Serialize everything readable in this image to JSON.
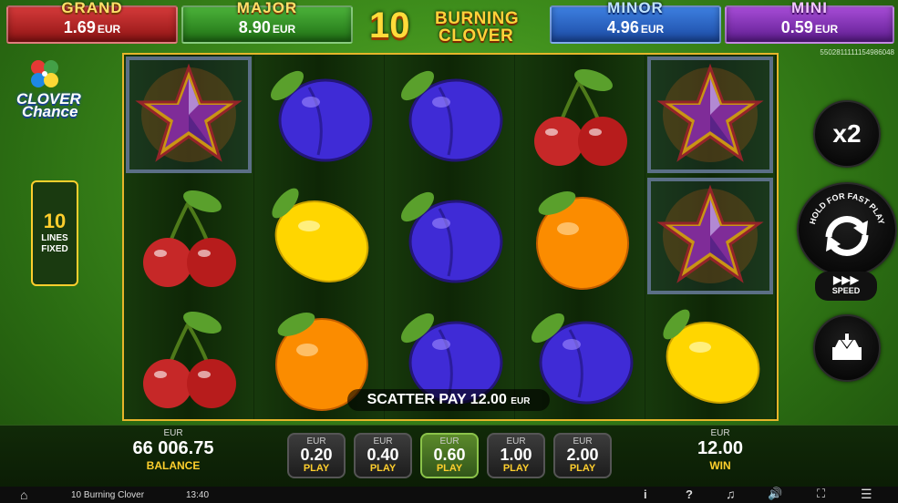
{
  "jackpots": {
    "grand": {
      "label": "GRAND",
      "value": "1.69",
      "currency": "EUR"
    },
    "major": {
      "label": "MAJOR",
      "value": "8.90",
      "currency": "EUR"
    },
    "minor": {
      "label": "MINOR",
      "value": "4.96",
      "currency": "EUR"
    },
    "mini": {
      "label": "MINI",
      "value": "0.59",
      "currency": "EUR"
    }
  },
  "logo": {
    "number": "10",
    "line1": "BURNING",
    "line2": "CLOVER"
  },
  "game_id": "5502811111154986048",
  "side_logo": {
    "line1": "CLOVER",
    "line2": "Chance"
  },
  "lines": {
    "count": "10",
    "line1": "LINES",
    "line2": "FIXED"
  },
  "reels": [
    [
      "star",
      "cherry",
      "cherry"
    ],
    [
      "plum",
      "lemon",
      "orange"
    ],
    [
      "plum",
      "plum",
      "plum"
    ],
    [
      "cherry",
      "orange",
      "plum"
    ],
    [
      "star",
      "star",
      "lemon"
    ]
  ],
  "scatter": {
    "label": "SCATTER PAY",
    "value": "12.00",
    "currency": "EUR"
  },
  "controls": {
    "multiplier": "x2",
    "hold_text": "HOLD FOR FAST PLAY",
    "speed_label": "SPEED",
    "spin_icon": "spin-arrows-icon",
    "autoplay_icon": "autoplay-tray-icon"
  },
  "balance": {
    "currency": "EUR",
    "value": "66 006.75",
    "label": "BALANCE"
  },
  "win": {
    "currency": "EUR",
    "value": "12.00",
    "label": "WIN"
  },
  "bets": [
    {
      "currency": "EUR",
      "value": "0.20",
      "label": "PLAY"
    },
    {
      "currency": "EUR",
      "value": "0.40",
      "label": "PLAY"
    },
    {
      "currency": "EUR",
      "value": "0.60",
      "label": "PLAY"
    },
    {
      "currency": "EUR",
      "value": "1.00",
      "label": "PLAY"
    },
    {
      "currency": "EUR",
      "value": "2.00",
      "label": "PLAY"
    }
  ],
  "active_bet": "0.60",
  "system_bar": {
    "title": "10 Burning Clover",
    "time": "13:40",
    "info": "i",
    "help": "?"
  }
}
